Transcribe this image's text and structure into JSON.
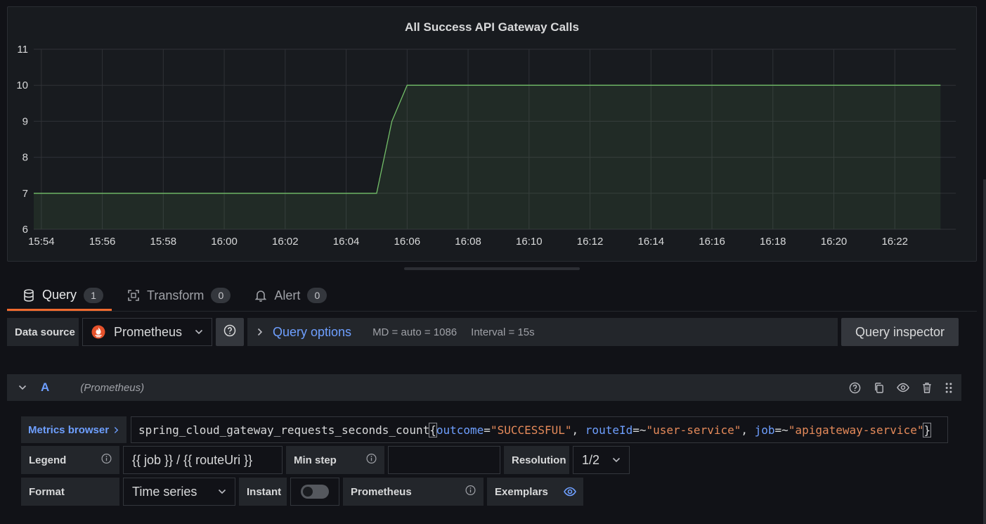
{
  "panel": {
    "title": "All Success API Gateway Calls"
  },
  "chart_data": {
    "type": "area",
    "title": "All Success API Gateway Calls",
    "x_ticks": [
      "15:54",
      "15:56",
      "15:58",
      "16:00",
      "16:02",
      "16:04",
      "16:06",
      "16:08",
      "16:10",
      "16:12",
      "16:14",
      "16:16",
      "16:18",
      "16:20",
      "16:22"
    ],
    "y_ticks": [
      6,
      7,
      8,
      9,
      10,
      11
    ],
    "ylim": [
      6,
      11
    ],
    "xlim": [
      "15:53:45",
      "16:24:00"
    ],
    "grid": true,
    "series": [
      {
        "x": [
          "15:53:45",
          "16:05:00",
          "16:05:30",
          "16:06:00",
          "16:23:30"
        ],
        "y": [
          7,
          7,
          9,
          10,
          10
        ],
        "color": "#73bf69"
      }
    ]
  },
  "tabs": [
    {
      "label": "Query",
      "count": "1",
      "icon": "database-icon"
    },
    {
      "label": "Transform",
      "count": "0",
      "icon": "transform-icon"
    },
    {
      "label": "Alert",
      "count": "0",
      "icon": "bell-icon"
    }
  ],
  "datasource": {
    "label": "Data source",
    "selected": "Prometheus",
    "query_options_label": "Query options",
    "md": "MD = auto = 1086",
    "interval": "Interval = 15s",
    "inspector_label": "Query inspector"
  },
  "query": {
    "ref": "A",
    "datasource_name": "(Prometheus)",
    "metrics_browser_label": "Metrics browser",
    "expr_metric": "spring_cloud_gateway_requests_seconds_count",
    "expr_open": "{",
    "expr_close": "}",
    "l1_key": "outcome",
    "l1_op": "=",
    "l1_val": "\"SUCCESSFUL\"",
    "sep1": ", ",
    "l2_key": "routeId",
    "l2_op": "=~",
    "l2_val": "\"user-service\"",
    "sep2": ", ",
    "l3_key": "job",
    "l3_op": "=~",
    "l3_val": "\"apigateway-service\"",
    "legend_label": "Legend",
    "legend_value": "{{ job }} / {{ routeUri }}",
    "min_step_label": "Min step",
    "min_step_value": "",
    "resolution_label": "Resolution",
    "resolution_value": "1/2",
    "format_label": "Format",
    "format_value": "Time series",
    "instant_label": "Instant",
    "instant_on": false,
    "prometheus_label": "Prometheus",
    "exemplars_label": "Exemplars"
  },
  "colors": {
    "accent": "#6e9fff",
    "active_tab": "#f06a2e",
    "series": "#73bf69"
  }
}
